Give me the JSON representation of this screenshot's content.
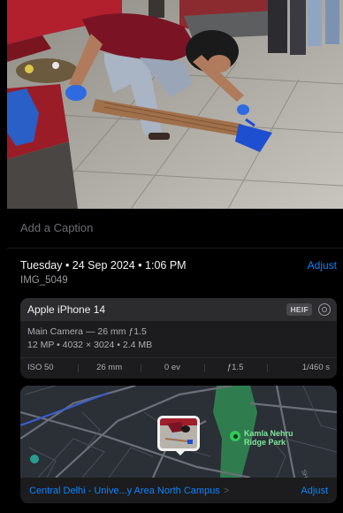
{
  "caption": {
    "placeholder": "Add a Caption"
  },
  "info": {
    "date": "Tuesday • 24 Sep 2024 • 1:06 PM",
    "adjust_label": "Adjust",
    "filename": "IMG_5049"
  },
  "camera": {
    "device": "Apple iPhone 14",
    "format_badge": "HEIF",
    "lens": "Main Camera — 26 mm ƒ1.5",
    "details": "12 MP • 4032 × 3024 • 2.4 MB",
    "specs": [
      "ISO 50",
      "26 mm",
      "0 ev",
      "ƒ1.5",
      "1/460 s"
    ]
  },
  "map": {
    "place_name": "Kamla Nehru Ridge Park",
    "place_line1": "Kamla Nehru",
    "place_line2": "Ridge Park",
    "road_label": "SHAM",
    "location": "Central Delhi - Unive...y Area North Campus",
    "chevron": ">",
    "adjust_label": "Adjust"
  },
  "colors": {
    "accent": "#0a84ff",
    "background": "#000000",
    "card": "#1c1c1e",
    "park": "#2f7d4f"
  },
  "icons": [
    "live-photo-icon",
    "park-pin-icon",
    "chevron-right-icon",
    "location-dot-icon"
  ]
}
